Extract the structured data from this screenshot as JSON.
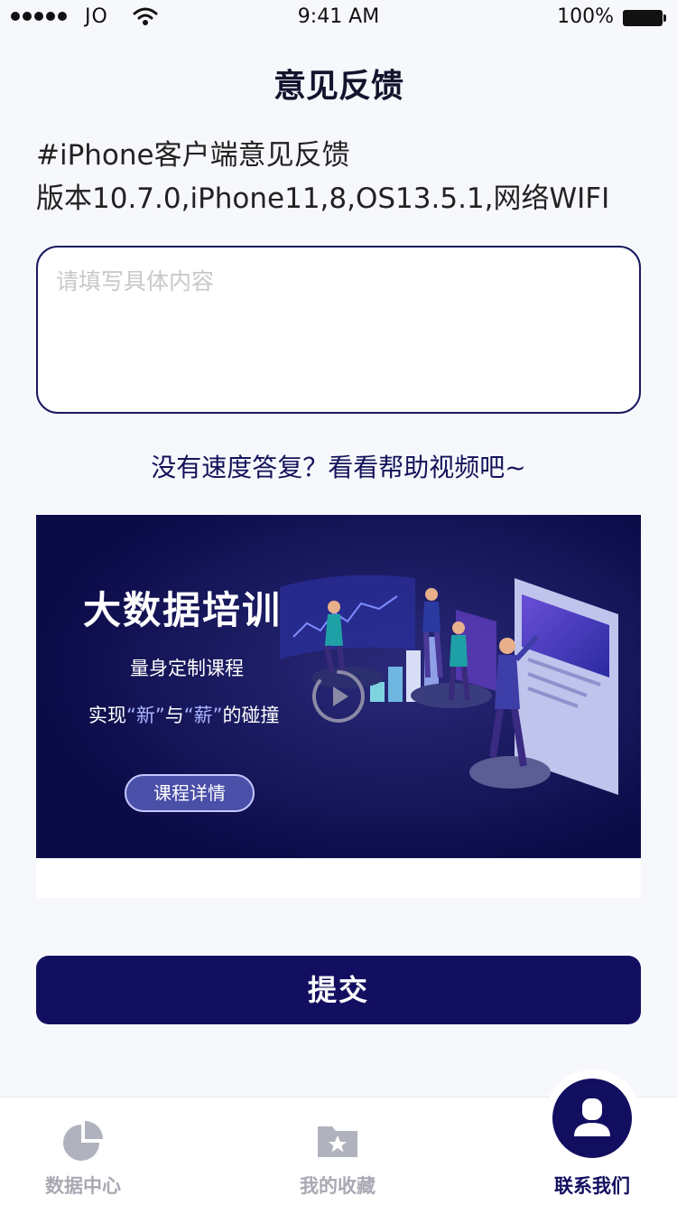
{
  "status_bar": {
    "carrier": "JO",
    "time": "9:41 AM",
    "battery": "100%",
    "icons": [
      "signal-dots-icon",
      "wifi-icon",
      "battery-icon"
    ]
  },
  "header": {
    "title": "意见反馈"
  },
  "info": {
    "line1": "#iPhone客户端意见反馈",
    "line2": "版本10.7.0,iPhone11,8,OS13.5.1,网络WIFI"
  },
  "feedback": {
    "value": "",
    "placeholder": "请填写具体内容"
  },
  "help_link": "没有速度答复？看看帮助视频吧~",
  "banner": {
    "title": "大数据培训",
    "subtitle": "量身定制课程",
    "slogan_pre": "实现",
    "slogan_hl1": "“新”",
    "slogan_mid": "与",
    "slogan_hl2": "“薪”",
    "slogan_post": "的碰撞",
    "button": "课程详情",
    "play_icon": "play-icon"
  },
  "submit_label": "提交",
  "tabbar": {
    "items": [
      {
        "label": "数据中心",
        "icon": "pie-chart-icon",
        "active": false
      },
      {
        "label": "我的收藏",
        "icon": "folder-star-icon",
        "active": false
      },
      {
        "label": "联系我们",
        "icon": "user-icon",
        "active": true
      }
    ]
  },
  "colors": {
    "primary": "#130f60",
    "inactive": "#a8a9b3",
    "banner_bg": "#0b0b48",
    "background": "#f6f8fc"
  }
}
